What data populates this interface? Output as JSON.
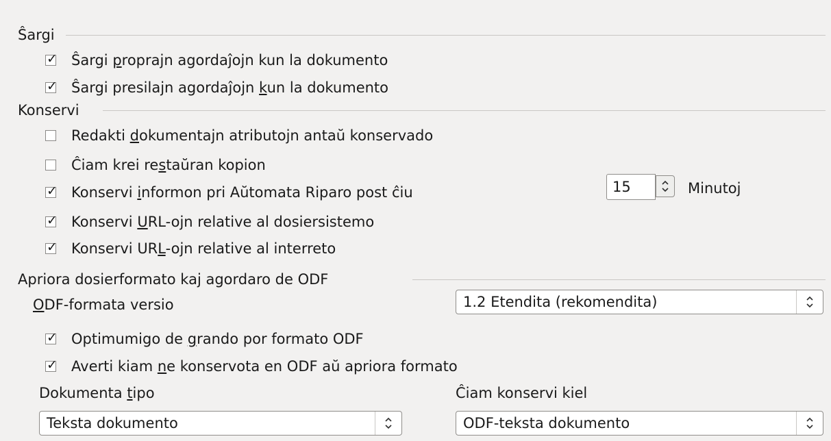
{
  "sections": {
    "sargi": {
      "title": "Ŝargi",
      "items": [
        {
          "pre": "Ŝargi ",
          "key": "p",
          "post": "roprajn agordaĵojn kun la dokumento",
          "checked": true
        },
        {
          "pre": "Ŝargi presilajn agordaĵojn ",
          "key": "k",
          "post": "un la dokumento",
          "checked": true
        }
      ]
    },
    "konservi": {
      "title": "Konservi",
      "items": [
        {
          "pre": "Redakti ",
          "key": "d",
          "post": "okumentajn atributojn antaŭ konservado",
          "checked": false
        },
        {
          "pre": "Ĉiam krei re",
          "key": "s",
          "post": "taŭran kopion",
          "checked": false
        },
        {
          "pre": "Konservi ",
          "key": "i",
          "post": "nformon pri Aŭtomata Riparo post ĉiu",
          "checked": true
        },
        {
          "pre": "Konservi ",
          "key": "U",
          "post": "RL-ojn relative al dosiersistemo",
          "checked": true
        },
        {
          "pre": "Konservi UR",
          "key": "L",
          "post": "-ojn relative al interreto",
          "checked": true
        }
      ],
      "autorecovery": {
        "value": "15",
        "unit": "Minutoj"
      }
    },
    "apriora": {
      "title": "Apriora dosierformato kaj agordaro de ODF",
      "odf_version": {
        "key": "O",
        "label_rest": "DF-formata versio",
        "value": "1.2 Etendita (rekomendita)"
      },
      "items": [
        {
          "pre": "Optimumigo de ",
          "key": "g",
          "post": "rando por formato ODF",
          "checked": true
        },
        {
          "pre": "Averti kiam ",
          "key": "n",
          "post": "e konservota en ODF aŭ apriora formato",
          "checked": true
        }
      ],
      "document_type": {
        "label_pre": "Dokumenta ",
        "key": "t",
        "label_post": "ipo",
        "value": "Teksta dokumento"
      },
      "always_save_as": {
        "label": "Ĉiam konservi kiel",
        "value": "ODF-teksta dokumento"
      }
    }
  }
}
